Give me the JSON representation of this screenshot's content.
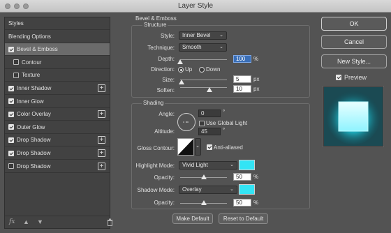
{
  "window": {
    "title": "Layer Style"
  },
  "sidebar": {
    "items": [
      {
        "label": "Styles",
        "checkbox": null,
        "plus": false
      },
      {
        "label": "Blending Options",
        "checkbox": null,
        "plus": false
      },
      {
        "label": "Bevel & Emboss",
        "checkbox": true,
        "plus": false
      },
      {
        "label": "Contour",
        "checkbox": false,
        "plus": false
      },
      {
        "label": "Texture",
        "checkbox": false,
        "plus": false
      },
      {
        "label": "Inner Shadow",
        "checkbox": true,
        "plus": true
      },
      {
        "label": "Inner Glow",
        "checkbox": true,
        "plus": false
      },
      {
        "label": "Color Overlay",
        "checkbox": true,
        "plus": true
      },
      {
        "label": "Outer Glow",
        "checkbox": true,
        "plus": false
      },
      {
        "label": "Drop Shadow",
        "checkbox": true,
        "plus": true
      },
      {
        "label": "Drop Shadow",
        "checkbox": true,
        "plus": true
      },
      {
        "label": "Drop Shadow",
        "checkbox": false,
        "plus": true
      }
    ],
    "footer": {
      "fx": "fx",
      "up_icon": "arrow-up-icon",
      "down_icon": "arrow-down-icon",
      "trash_icon": "trash-icon"
    }
  },
  "bevel": {
    "heading": "Bevel & Emboss",
    "structure": {
      "heading": "Structure",
      "style_label": "Style:",
      "style_value": "Inner Bevel",
      "technique_label": "Technique:",
      "technique_value": "Smooth",
      "depth_label": "Depth:",
      "depth_value": "100",
      "depth_unit": "%",
      "direction_label": "Direction:",
      "direction_up": "Up",
      "direction_down": "Down",
      "direction_selected": "Up",
      "size_label": "Size:",
      "size_value": "5",
      "size_unit": "px",
      "soften_label": "Soften:",
      "soften_value": "10",
      "soften_unit": "px"
    },
    "shading": {
      "heading": "Shading",
      "angle_label": "Angle:",
      "angle_value": "0",
      "angle_unit": "°",
      "global_light_label": "Use Global Light",
      "global_light_checked": false,
      "altitude_label": "Altitude:",
      "altitude_value": "45",
      "altitude_unit": "°",
      "gloss_label": "Gloss Contour:",
      "antialiased_label": "Anti-aliased",
      "antialiased_checked": true,
      "highlight_label": "Highlight Mode:",
      "highlight_value": "Vivid Light",
      "highlight_color": "#33e4f5",
      "hl_opacity_label": "Opacity:",
      "hl_opacity_value": "50",
      "hl_opacity_unit": "%",
      "shadow_label": "Shadow Mode:",
      "shadow_value": "Overlay",
      "shadow_color": "#33e4f5",
      "sh_opacity_label": "Opacity:",
      "sh_opacity_value": "50",
      "sh_opacity_unit": "%"
    },
    "make_default": "Make Default",
    "reset_default": "Reset to Default"
  },
  "actions": {
    "ok": "OK",
    "cancel": "Cancel",
    "new_style": "New Style...",
    "preview_label": "Preview",
    "preview_checked": true
  }
}
